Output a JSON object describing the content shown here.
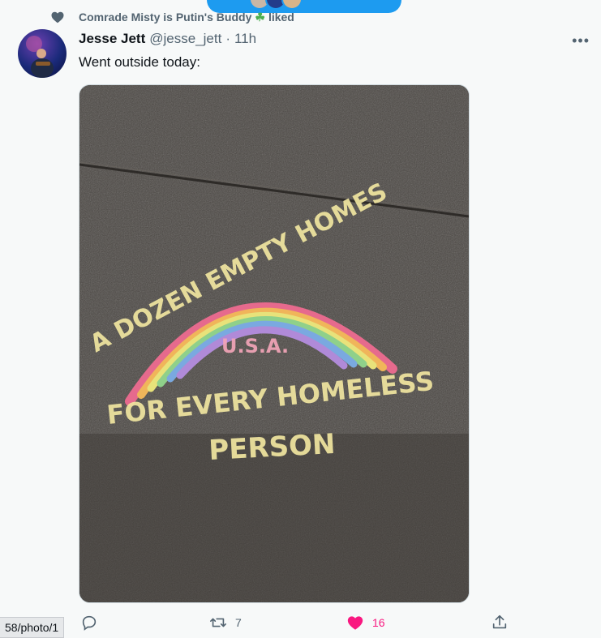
{
  "social_context": {
    "liker_name": "Comrade Misty is Putin's Buddy",
    "clover_glyph": "☘",
    "action": "liked"
  },
  "tweet": {
    "author_name": "Jesse Jett",
    "author_handle": "@jesse_jett",
    "separator": "·",
    "time": "11h",
    "more_glyph": "•••",
    "text": "Went outside today:",
    "image_chalk_text": [
      "A DOZEN EMPTY HOMES",
      "U.S.A.",
      "FOR EVERY HOMELESS",
      "PERSON"
    ]
  },
  "actions": {
    "reply_count": "",
    "retweet_count": "7",
    "like_count": "16",
    "liked": true
  },
  "status_url": "58/photo/1",
  "colors": {
    "accent": "#1d9bf0",
    "like": "#f91880",
    "muted": "#536471"
  },
  "icons": [
    "heart-icon",
    "reply-icon",
    "retweet-icon",
    "like-icon",
    "share-icon",
    "more-icon",
    "clover-icon"
  ]
}
